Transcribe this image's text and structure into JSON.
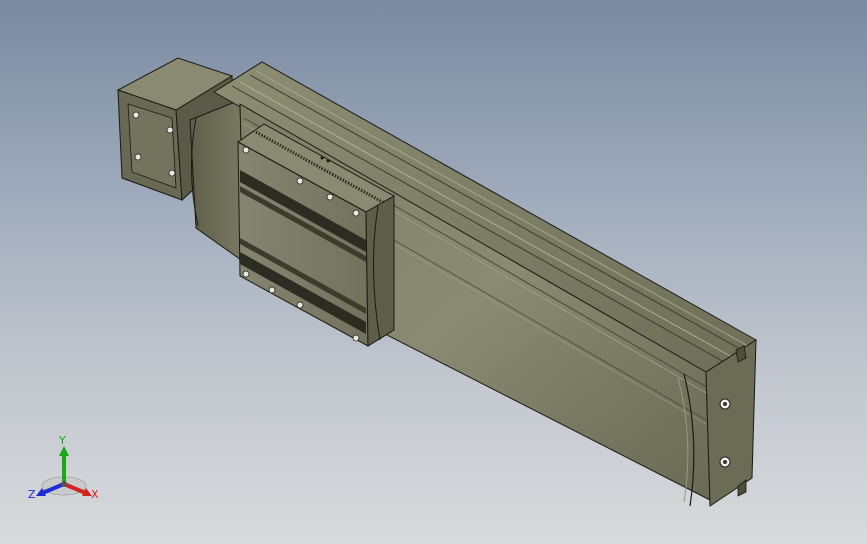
{
  "viewport": {
    "background_top": "#7a8aa0",
    "background_bottom": "#d8dadc"
  },
  "model": {
    "body_color": "#75755e",
    "body_light": "#8f8f76",
    "body_dark": "#4e4e3c",
    "edge_color": "#1a1a14",
    "carriage_color": "#7d7d66",
    "endcap_color": "#6d6d58",
    "motor_color": "#6a6a55"
  },
  "triad": {
    "x_label": "X",
    "y_label": "Y",
    "z_label": "Z",
    "x_color": "#d42020",
    "y_color": "#18a818",
    "z_color": "#1c2cd8"
  }
}
